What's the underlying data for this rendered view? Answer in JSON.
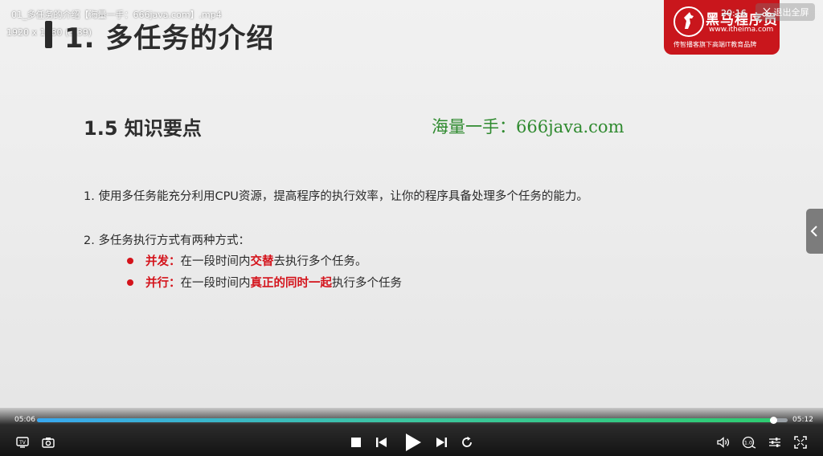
{
  "video": {
    "filename_overlay": "01_多任务的介绍【海量一手：666java.com】.mp4",
    "resolution_overlay": "1920 x 1080 (3.39)",
    "clock": "20:16",
    "exit_fullscreen_label": "退出全屏"
  },
  "slide": {
    "title": "1. 多任务的介绍",
    "section_heading": "1.5 知识要点",
    "watermark": "海量一手：666java.com",
    "point1": "1. 使用多任务能充分利用CPU资源，提高程序的执行效率，让你的程序具备处理多个任务的能力。",
    "point2": "2. 多任务执行方式有两种方式：",
    "sub1": {
      "term": "并发：",
      "pre": "在一段时间内",
      "emph": "交替",
      "post": "去执行多个任务。"
    },
    "sub2": {
      "term": "并行：",
      "pre": "在一段时间内",
      "emph": "真正的同时一起",
      "post": "执行多个任务"
    }
  },
  "brand": {
    "name": "黑马程序员",
    "url": "www.itheima.com",
    "slogan": "传智播客旗下高端IT教育品牌"
  },
  "player": {
    "current_time": "05:06",
    "total_time": "05:12",
    "progress": 0.981,
    "quality_label": "1.0"
  },
  "icons": [
    "tv-icon",
    "camera-icon",
    "stop-icon",
    "prev-icon",
    "play-icon",
    "next-icon",
    "replay-icon",
    "volume-icon",
    "speed-icon",
    "settings-icon",
    "fullscreen-icon",
    "chevron-left-icon",
    "scissors-icon"
  ],
  "colors": {
    "brand_red": "#c9161c",
    "emphasis_red": "#d4131b",
    "watermark_green": "#2f8a2f"
  }
}
